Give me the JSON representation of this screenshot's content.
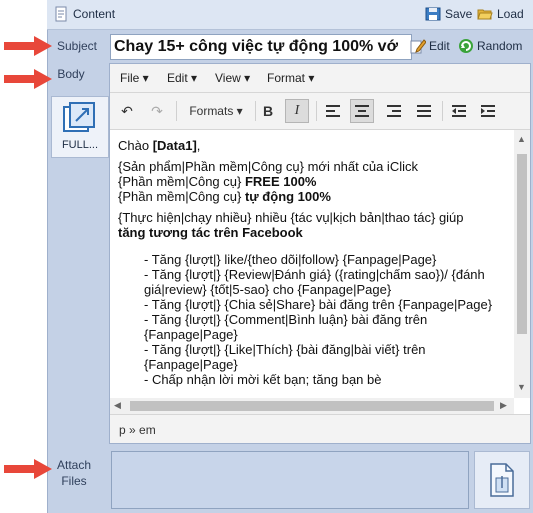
{
  "topbar": {
    "title": "Content",
    "save_label": "Save",
    "load_label": "Load"
  },
  "labels": {
    "subject": "Subject",
    "body": "Body",
    "attach_line1": "Attach",
    "attach_line2": "Files"
  },
  "subject": {
    "value": "Chay 15+ công việc tự động 100% vớ",
    "edit_label": "Edit",
    "random_label": "Random"
  },
  "full_button": {
    "label": "FULL..."
  },
  "editor": {
    "menus": [
      "File",
      "Edit",
      "View",
      "Format"
    ],
    "formats_label": "Formats",
    "status_path": "p » em",
    "content": {
      "greeting_prefix": "Chào ",
      "greeting_bold": "[Data1]",
      "greeting_suffix": ",",
      "line1": "{Sản phẩm|Phần mềm|Công cụ} mới nhất của iClick",
      "line2_prefix": "{Phần mềm|Công cụ} ",
      "line2_bold": "FREE 100%",
      "line3_prefix": "{Phần mềm|Công cụ} ",
      "line3_bold": "tự động 100%",
      "para2": "{Thực hiện|chạy nhiều} nhiều {tác vụ|kịch bản|thao tác} giúp",
      "para2_bold": "tăng tương tác trên Facebook",
      "items": [
        "- Tăng {lượt|} like/{theo dõi|follow} {Fanpage|Page}",
        "- Tăng {lượt|} {Review|Đánh giá} ({rating|chấm sao})/ {đánh giá|review} {tốt|5-sao} cho {Fanpage|Page}",
        "- Tăng {lượt|} {Chia sẻ|Share} bài đăng trên {Fanpage|Page}",
        "- Tăng {lượt|} {Comment|Bình luận} bài đăng trên {Fanpage|Page}",
        "- Tăng {lượt|}  {Like|Thích} {bài đăng|bài viết} trên {Fanpage|Page}",
        "- Chấp nhận lời mời kết bạn; tăng bạn bè"
      ]
    }
  },
  "colors": {
    "panel": "#c4d1e6",
    "arrow": "#e8473a",
    "accent": "#2f6fb5"
  }
}
